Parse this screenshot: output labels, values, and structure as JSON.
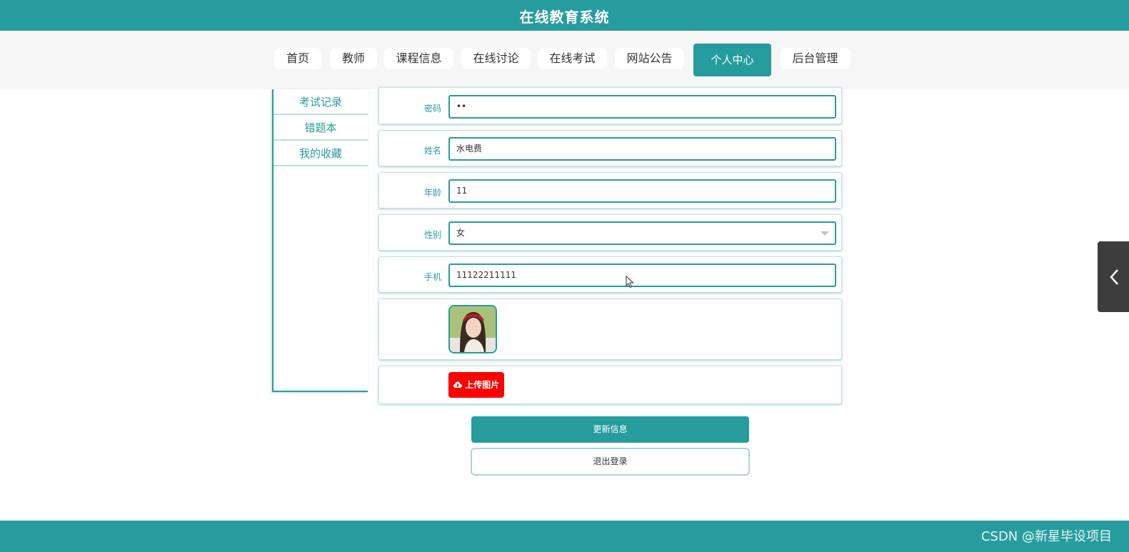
{
  "header": {
    "title": "在线教育系统"
  },
  "nav": {
    "items": [
      {
        "label": "首页"
      },
      {
        "label": "教师"
      },
      {
        "label": "课程信息"
      },
      {
        "label": "在线讨论"
      },
      {
        "label": "在线考试"
      },
      {
        "label": "网站公告"
      },
      {
        "label": "个人中心"
      },
      {
        "label": "后台管理"
      }
    ],
    "active": "个人中心"
  },
  "sidebar": {
    "items": [
      {
        "label": "考试记录"
      },
      {
        "label": "错题本"
      },
      {
        "label": "我的收藏"
      }
    ]
  },
  "form": {
    "password": {
      "label": "密码",
      "value": "••"
    },
    "name": {
      "label": "姓名",
      "value": "水电费"
    },
    "age": {
      "label": "年龄",
      "value": "11"
    },
    "gender": {
      "label": "性别",
      "value": "女"
    },
    "phone": {
      "label": "手机",
      "value": "11122211111"
    },
    "upload_label": "上传图片"
  },
  "actions": {
    "update_label": "更新信息",
    "logout_label": "退出登录"
  },
  "footer": {
    "watermark": "CSDN @新星毕设项目"
  },
  "colors": {
    "primary": "#279c9e",
    "upload": "#ff0000",
    "nav_band": "#f6f6f6"
  }
}
